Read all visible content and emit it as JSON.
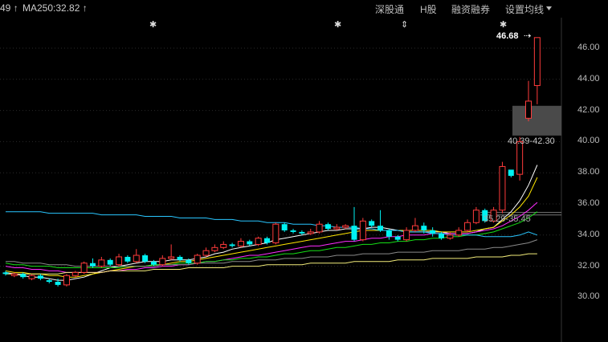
{
  "header": {
    "ma_prev_fragment": "49",
    "ma_prev_arrow": "↑",
    "ma250_label": "MA250:32.82",
    "ma250_arrow": "↑",
    "colors": {
      "ma_prev": "#29c6ff",
      "ma250": "#f2ec7a"
    }
  },
  "menu": {
    "items": [
      {
        "label": "深股通"
      },
      {
        "label": "H股"
      },
      {
        "label": "融资融券"
      },
      {
        "label": "设置均线"
      }
    ],
    "dropdown_icon": "caret-down-icon"
  },
  "markers": {
    "glyph": "✱",
    "arrow_glyph": "⇕"
  },
  "annotations": {
    "high_price": "46.68",
    "high_arrow": "⇢",
    "upper_gap_range": "40.39-42.30",
    "lower_gap_range": "35.29-35.45"
  },
  "chart_data": {
    "type": "candlestick",
    "y_ticks": [
      "46.00",
      "44.00",
      "42.00",
      "40.00",
      "38.00",
      "36.00",
      "34.00",
      "32.00",
      "30.00"
    ],
    "ylim": [
      29.0,
      48.0
    ],
    "grid": "horizontal dotted",
    "candles": [
      [
        31.6,
        31.5,
        31.7,
        31.4
      ],
      [
        31.4,
        31.5,
        31.6,
        31.3
      ],
      [
        31.5,
        31.3,
        31.6,
        31.2
      ],
      [
        31.2,
        31.4,
        31.5,
        31.1
      ],
      [
        31.4,
        31.2,
        31.5,
        31.1
      ],
      [
        31.1,
        31.0,
        31.2,
        30.9
      ],
      [
        31.0,
        30.8,
        31.2,
        30.7
      ],
      [
        30.8,
        31.4,
        31.5,
        30.7
      ],
      [
        31.4,
        31.6,
        31.7,
        31.3
      ],
      [
        31.6,
        32.2,
        32.3,
        31.5
      ],
      [
        32.2,
        32.0,
        32.5,
        31.9
      ],
      [
        32.0,
        32.4,
        32.6,
        31.9
      ],
      [
        32.4,
        32.1,
        32.5,
        32.0
      ],
      [
        32.1,
        32.6,
        32.8,
        32.0
      ],
      [
        32.6,
        32.3,
        32.7,
        32.2
      ],
      [
        32.3,
        32.7,
        33.1,
        32.2
      ],
      [
        32.7,
        32.3,
        32.8,
        32.2
      ],
      [
        32.3,
        32.1,
        32.4,
        32.0
      ],
      [
        32.1,
        32.5,
        32.7,
        32.0
      ],
      [
        32.5,
        32.6,
        33.4,
        32.4
      ],
      [
        32.6,
        32.4,
        32.7,
        32.3
      ],
      [
        32.4,
        32.2,
        32.5,
        32.1
      ],
      [
        32.2,
        32.7,
        32.8,
        32.1
      ],
      [
        32.7,
        33.0,
        33.2,
        32.6
      ],
      [
        33.0,
        33.2,
        33.4,
        32.9
      ],
      [
        33.2,
        33.4,
        33.6,
        33.1
      ],
      [
        33.4,
        33.3,
        33.5,
        33.2
      ],
      [
        33.3,
        33.6,
        33.8,
        33.2
      ],
      [
        33.6,
        33.4,
        33.7,
        33.3
      ],
      [
        33.4,
        33.8,
        33.9,
        33.3
      ],
      [
        33.8,
        33.5,
        33.9,
        33.4
      ],
      [
        33.5,
        34.7,
        34.8,
        33.4
      ],
      [
        34.7,
        34.3,
        34.8,
        34.2
      ],
      [
        34.3,
        34.2,
        34.4,
        34.1
      ],
      [
        34.2,
        34.1,
        34.3,
        34.0
      ],
      [
        34.1,
        34.2,
        34.4,
        34.0
      ],
      [
        34.2,
        34.7,
        34.9,
        34.1
      ],
      [
        34.7,
        34.4,
        34.8,
        34.3
      ],
      [
        34.4,
        34.5,
        34.7,
        34.3
      ],
      [
        34.5,
        34.6,
        34.7,
        34.4
      ],
      [
        34.6,
        33.7,
        35.8,
        33.6
      ],
      [
        33.7,
        34.9,
        35.1,
        33.6
      ],
      [
        34.9,
        34.6,
        35.0,
        34.5
      ],
      [
        34.6,
        34.3,
        35.6,
        34.2
      ],
      [
        34.3,
        33.9,
        34.4,
        33.7
      ],
      [
        33.9,
        33.7,
        34.0,
        33.6
      ],
      [
        33.7,
        34.3,
        34.5,
        33.6
      ],
      [
        34.3,
        34.6,
        35.1,
        34.2
      ],
      [
        34.6,
        34.3,
        34.8,
        34.1
      ],
      [
        34.3,
        34.1,
        34.5,
        33.9
      ],
      [
        34.1,
        33.8,
        34.2,
        33.7
      ],
      [
        33.8,
        34.0,
        34.2,
        33.7
      ],
      [
        34.0,
        34.3,
        34.5,
        33.9
      ],
      [
        34.3,
        34.8,
        35.0,
        34.2
      ],
      [
        34.8,
        35.6,
        35.8,
        34.7
      ],
      [
        35.6,
        34.9,
        35.7,
        34.8
      ],
      [
        34.9,
        35.6,
        35.8,
        34.8
      ],
      [
        35.6,
        38.4,
        38.7,
        35.4
      ],
      [
        38.2,
        37.8,
        38.1,
        37.7
      ],
      [
        37.9,
        40.0,
        40.3,
        37.5
      ],
      [
        41.5,
        42.6,
        43.9,
        41.3
      ],
      [
        43.6,
        46.68,
        46.68,
        42.4
      ]
    ],
    "moving_averages": [
      {
        "color": "#ffffff",
        "values": [
          31.6,
          31.5,
          31.4,
          31.3,
          31.3,
          31.2,
          31.1,
          31.1,
          31.2,
          31.3,
          31.5,
          31.7,
          31.9,
          32.0,
          32.1,
          32.2,
          32.3,
          32.3,
          32.3,
          32.4,
          32.4,
          32.4,
          32.5,
          32.6,
          32.8,
          32.9,
          33.1,
          33.2,
          33.3,
          33.4,
          33.5,
          33.7,
          33.8,
          33.9,
          34.0,
          34.1,
          34.2,
          34.3,
          34.3,
          34.4,
          34.4,
          34.4,
          34.5,
          34.5,
          34.4,
          34.3,
          34.2,
          34.2,
          34.2,
          34.2,
          34.2,
          34.1,
          34.1,
          34.1,
          34.2,
          34.4,
          34.5,
          35.0,
          35.5,
          36.2,
          37.2,
          38.5
        ]
      },
      {
        "color": "#ffe600",
        "values": [
          31.7,
          31.6,
          31.6,
          31.5,
          31.5,
          31.4,
          31.4,
          31.3,
          31.3,
          31.4,
          31.5,
          31.6,
          31.7,
          31.8,
          31.9,
          32.0,
          32.0,
          32.1,
          32.1,
          32.2,
          32.3,
          32.3,
          32.4,
          32.5,
          32.6,
          32.7,
          32.8,
          32.9,
          33.0,
          33.1,
          33.2,
          33.3,
          33.4,
          33.5,
          33.6,
          33.7,
          33.8,
          33.9,
          34.0,
          34.1,
          34.2,
          34.3,
          34.3,
          34.3,
          34.3,
          34.3,
          34.3,
          34.3,
          34.3,
          34.3,
          34.2,
          34.2,
          34.2,
          34.2,
          34.3,
          34.4,
          34.5,
          34.9,
          35.3,
          35.8,
          36.5,
          37.7
        ]
      },
      {
        "color": "#ff2bff",
        "values": [
          32.0,
          31.9,
          31.9,
          31.8,
          31.8,
          31.7,
          31.7,
          31.6,
          31.6,
          31.6,
          31.6,
          31.6,
          31.7,
          31.7,
          31.8,
          31.8,
          31.9,
          31.9,
          32.0,
          32.0,
          32.1,
          32.1,
          32.2,
          32.3,
          32.3,
          32.4,
          32.5,
          32.6,
          32.7,
          32.7,
          32.8,
          32.9,
          33.0,
          33.1,
          33.2,
          33.3,
          33.3,
          33.4,
          33.5,
          33.6,
          33.6,
          33.7,
          33.8,
          33.8,
          33.9,
          33.9,
          34.0,
          34.0,
          34.0,
          34.1,
          34.1,
          34.1,
          34.1,
          34.1,
          34.2,
          34.3,
          34.4,
          34.6,
          34.9,
          35.2,
          35.6,
          36.1
        ]
      },
      {
        "color": "#16e016",
        "values": [
          32.2,
          32.1,
          32.1,
          32.0,
          32.0,
          32.0,
          31.9,
          31.9,
          31.9,
          31.9,
          31.9,
          31.9,
          31.9,
          31.9,
          32.0,
          32.0,
          32.0,
          32.1,
          32.1,
          32.1,
          32.2,
          32.2,
          32.2,
          32.3,
          32.3,
          32.4,
          32.4,
          32.5,
          32.5,
          32.6,
          32.6,
          32.7,
          32.8,
          32.8,
          32.9,
          33.0,
          33.0,
          33.1,
          33.2,
          33.2,
          33.3,
          33.4,
          33.4,
          33.5,
          33.5,
          33.6,
          33.6,
          33.7,
          33.7,
          33.8,
          33.8,
          33.9,
          33.9,
          34.0,
          34.0,
          34.1,
          34.2,
          34.4,
          34.6,
          34.8,
          35.1,
          35.5
        ]
      },
      {
        "color": "#8a8a8a",
        "values": [
          32.3,
          32.3,
          32.2,
          32.2,
          32.2,
          32.1,
          32.1,
          32.1,
          32.0,
          32.0,
          32.0,
          32.0,
          32.0,
          32.0,
          32.0,
          32.0,
          32.0,
          32.0,
          32.1,
          32.1,
          32.1,
          32.1,
          32.2,
          32.2,
          32.2,
          32.2,
          32.3,
          32.3,
          32.3,
          32.4,
          32.4,
          32.4,
          32.5,
          32.5,
          32.5,
          32.6,
          32.6,
          32.6,
          32.7,
          32.7,
          32.7,
          32.8,
          32.8,
          32.8,
          32.8,
          32.9,
          32.9,
          32.9,
          32.9,
          33.0,
          33.0,
          33.0,
          33.0,
          33.1,
          33.1,
          33.1,
          33.2,
          33.2,
          33.3,
          33.4,
          33.5,
          33.7
        ]
      },
      {
        "color": "#f2ec7a",
        "values": [
          31.5,
          31.5,
          31.5,
          31.5,
          31.5,
          31.5,
          31.5,
          31.6,
          31.6,
          31.6,
          31.6,
          31.6,
          31.7,
          31.7,
          31.7,
          31.7,
          31.7,
          31.8,
          31.8,
          31.8,
          31.8,
          31.9,
          31.9,
          31.9,
          31.9,
          31.9,
          32.0,
          32.0,
          32.0,
          32.0,
          32.1,
          32.1,
          32.1,
          32.1,
          32.1,
          32.2,
          32.2,
          32.2,
          32.2,
          32.2,
          32.3,
          32.3,
          32.3,
          32.3,
          32.3,
          32.4,
          32.4,
          32.4,
          32.4,
          32.5,
          32.5,
          32.5,
          32.5,
          32.5,
          32.6,
          32.6,
          32.6,
          32.6,
          32.7,
          32.7,
          32.8,
          32.8
        ]
      },
      {
        "color": "#29c6ff",
        "values": [
          35.5,
          35.5,
          35.5,
          35.5,
          35.5,
          35.4,
          35.4,
          35.4,
          35.4,
          35.4,
          35.4,
          35.3,
          35.3,
          35.3,
          35.3,
          35.3,
          35.2,
          35.2,
          35.2,
          35.2,
          35.1,
          35.1,
          35.1,
          35.1,
          35.0,
          35.0,
          35.0,
          34.9,
          34.9,
          34.9,
          34.8,
          34.8,
          34.8,
          34.7,
          34.7,
          34.7,
          34.6,
          34.6,
          34.5,
          34.5,
          34.5,
          34.4,
          34.4,
          34.3,
          34.3,
          34.3,
          34.2,
          34.2,
          34.2,
          34.1,
          34.1,
          34.0,
          34.0,
          34.0,
          34.0,
          33.9,
          33.9,
          33.9,
          33.9,
          34.0,
          34.2,
          34.0
        ]
      }
    ],
    "gaps": [
      [
        40.39,
        42.3
      ],
      [
        35.29,
        35.45
      ]
    ]
  }
}
